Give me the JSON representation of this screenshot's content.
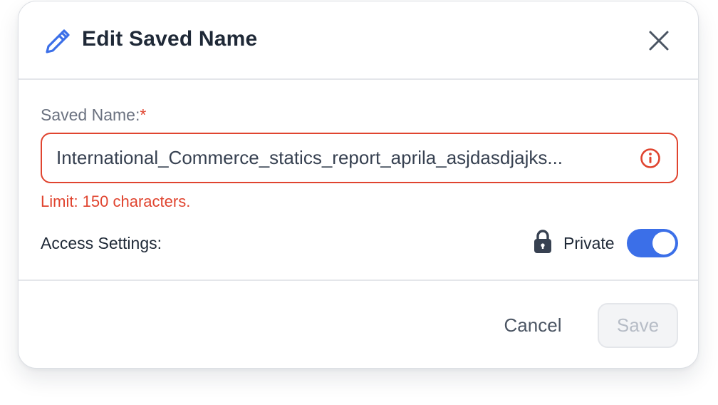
{
  "dialog": {
    "title": "Edit Saved Name",
    "close_icon": "close-icon",
    "title_icon": "pencil-icon"
  },
  "form": {
    "name_label": "Saved Name:",
    "required_marker": "*",
    "name_value": "International_Commerce_statics_report_aprila_asjdasdjajksdhkjashdkjahsdkjhaskjdhaksjdhkajshdkjashdkjahsdkjahsdkjahsdkjhaskdjhaskjdhaksjdhkajsdhkjashdkjashdk",
    "name_display": "International_Commerce_statics_report_aprila_asjdasdjajks...",
    "error_icon": "info-circle-icon",
    "error_message": "Limit: 150 characters.",
    "access_label": "Access Settings:",
    "privacy_icon": "lock-icon",
    "privacy_label": "Private",
    "privacy_enabled": true
  },
  "footer": {
    "cancel_label": "Cancel",
    "save_label": "Save",
    "save_disabled": true
  },
  "colors": {
    "accent": "#3b6fe8",
    "error": "#e0442f",
    "text_primary": "#1f2937",
    "text_muted": "#6b7280"
  }
}
